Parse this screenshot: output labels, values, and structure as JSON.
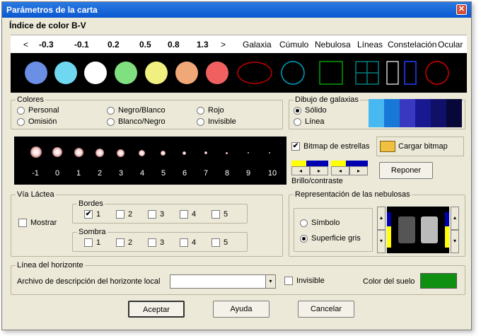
{
  "window": {
    "title": "Parámetros de la carta",
    "close": "✕"
  },
  "bv": {
    "heading": "Índice de color B-V",
    "left_arrow": "<",
    "right_arrow": ">",
    "values": [
      "-0.3",
      "-0.1",
      "0.2",
      "0.5",
      "0.8",
      "1.3"
    ],
    "objects": [
      "Galaxia",
      "Cúmulo",
      "Nebulosa",
      "Líneas",
      "Constelación",
      "Ocular"
    ],
    "swatch_colors": [
      "#6c8fe6",
      "#6fd8f0",
      "#ffffff",
      "#80e080",
      "#f0f080",
      "#f0a878",
      "#f06060"
    ],
    "object_colors": [
      "#c00000",
      "#00a0c0",
      "#00a000",
      "#008080",
      "#2040ff",
      "#d00000"
    ]
  },
  "colores": {
    "legend": "Colores",
    "options": [
      {
        "label": "Personal",
        "selected": false
      },
      {
        "label": "Omisión",
        "selected": false
      },
      {
        "label": "Negro/Blanco",
        "selected": false
      },
      {
        "label": "Blanco/Negro",
        "selected": false
      },
      {
        "label": "Rojo",
        "selected": false
      },
      {
        "label": "Invisible",
        "selected": false
      }
    ]
  },
  "galaxias": {
    "legend": "Dibujo de galaxias",
    "solid": "Sólido",
    "line": "Línea",
    "gradient": [
      "#48b8f0",
      "#1878d8",
      "#3838c0",
      "#181890",
      "#101068",
      "#080838"
    ]
  },
  "stars": {
    "labels": [
      "-1",
      "0",
      "1",
      "2",
      "3",
      "4",
      "5",
      "6",
      "7",
      "8",
      "9",
      "10"
    ]
  },
  "bitmap": {
    "checkbox_label": "Bitmap de estrellas",
    "checked": true,
    "load_label": "Cargar bitmap",
    "brightness_label": "Brillo/contraste",
    "reset_label": "Reponer",
    "arrow_left": "◂",
    "arrow_right": "▸"
  },
  "via_lactea": {
    "legend": "Vía Láctea",
    "show_label": "Mostrar",
    "borders_legend": "Bordes",
    "shade_legend": "Sombra",
    "levels": [
      "1",
      "2",
      "3",
      "4",
      "5"
    ],
    "border_checked": [
      true,
      false,
      false,
      false,
      false
    ]
  },
  "nebulas": {
    "legend": "Representación de las nebulosas",
    "symbol": "Símbolo",
    "gray": "Superficie gris",
    "up": "▴",
    "down": "▾"
  },
  "horizon": {
    "legend": "Línea del horizonte",
    "file_label": "Archivo de descripción del horizonte local",
    "file_value": "",
    "dropdown_arrow": "▾",
    "invisible_label": "Invisible",
    "ground_label": "Color del suelo",
    "ground_color": "#109010"
  },
  "buttons": {
    "ok": "Aceptar",
    "help": "Ayuda",
    "cancel": "Cancelar"
  }
}
